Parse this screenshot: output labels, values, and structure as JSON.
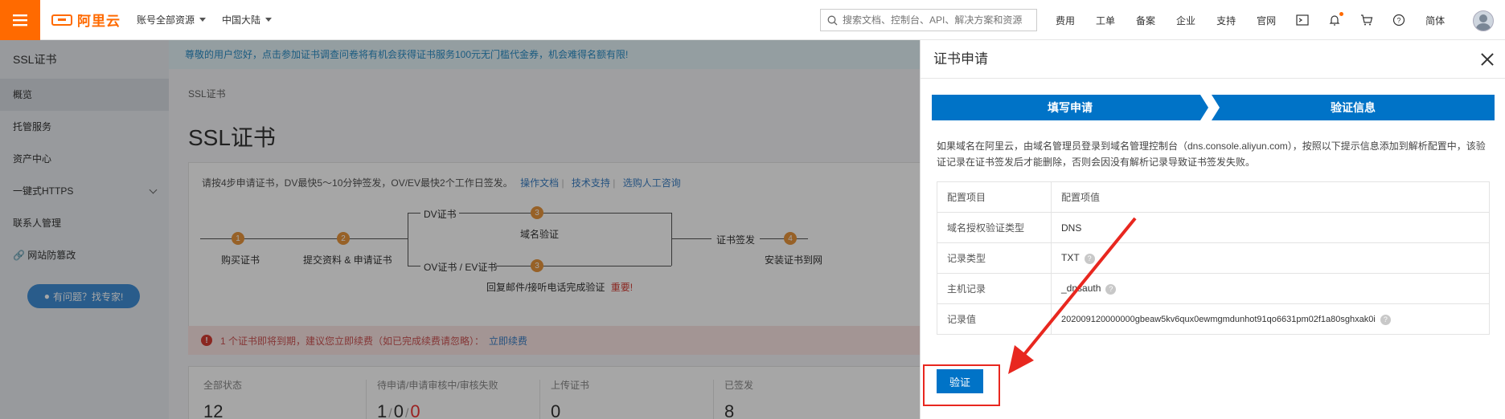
{
  "topbar": {
    "logo_text": "阿里云",
    "account_select": "账号全部资源",
    "region_select": "中国大陆",
    "search_placeholder": "搜索文档、控制台、API、解决方案和资源",
    "nav": [
      "费用",
      "工单",
      "备案",
      "企业",
      "支持",
      "官网"
    ],
    "lang": "简体",
    "accent": "#ff6a00"
  },
  "sidebar": {
    "title": "SSL证书",
    "items": [
      {
        "label": "概览",
        "active": true
      },
      {
        "label": "托管服务"
      },
      {
        "label": "资产中心"
      },
      {
        "label": "一键式HTTPS",
        "expandable": true
      },
      {
        "label": "联系人管理"
      },
      {
        "label": "网站防篡改"
      }
    ],
    "help_button": "有问题？找专家!"
  },
  "main": {
    "notice": "尊敬的用户您好，点击参加证书调查问卷将有机会获得证书服务100元无门槛代金券，机会难得名额有限!",
    "breadcrumb": "SSL证书",
    "title": "SSL证书",
    "steps_intro": "请按4步申请证书，DV最快5～10分钟签发，OV/EV最快2个工作日签发。",
    "links": [
      "操作文档",
      "技术支持",
      "选购人工咨询"
    ],
    "steps": {
      "s1": "购买证书",
      "s2": "提交资料 & 申请证书",
      "dv": "DV证书",
      "dv_step": "域名验证",
      "ov": "OV证书 / EV证书",
      "ov_step": "回复邮件/接听电话完成验证",
      "ov_important": "重要!",
      "issue": "证书签发",
      "s4": "安装证书到网"
    },
    "alert": "1 个证书即将到期，建议您立即续费（如已完成续费请忽略）：",
    "alert_link": "立即续费",
    "stats": [
      {
        "label": "全部状态",
        "value": "12"
      },
      {
        "label": "待申请/申请审核中/审核失败",
        "v1": "1",
        "v2": "0",
        "v3": "0"
      },
      {
        "label": "上传证书",
        "value": "0"
      },
      {
        "label": "已签发",
        "value": "8"
      }
    ]
  },
  "panel": {
    "title": "证书申请",
    "wizard": [
      "填写申请",
      "验证信息"
    ],
    "desc": "如果域名在阿里云，由域名管理员登录到域名管理控制台（dns.console.aliyun.com），按照以下提示信息添加到解析配置中，该验证记录在证书签发后才能删除，否则会因没有解析记录导致证书签发失败。",
    "table": {
      "headers": [
        "配置项目",
        "配置项值"
      ],
      "rows": [
        {
          "key": "域名授权验证类型",
          "value": "DNS",
          "help": false
        },
        {
          "key": "记录类型",
          "value": "TXT",
          "help": true
        },
        {
          "key": "主机记录",
          "value": "_dnsauth",
          "help": true
        },
        {
          "key": "记录值",
          "value": "202009120000000gbeaw5kv6qux0ewmgmdunhot91qo6631pm02f1a80sghxak0i",
          "help": true
        }
      ]
    },
    "verify_button": "验证"
  }
}
